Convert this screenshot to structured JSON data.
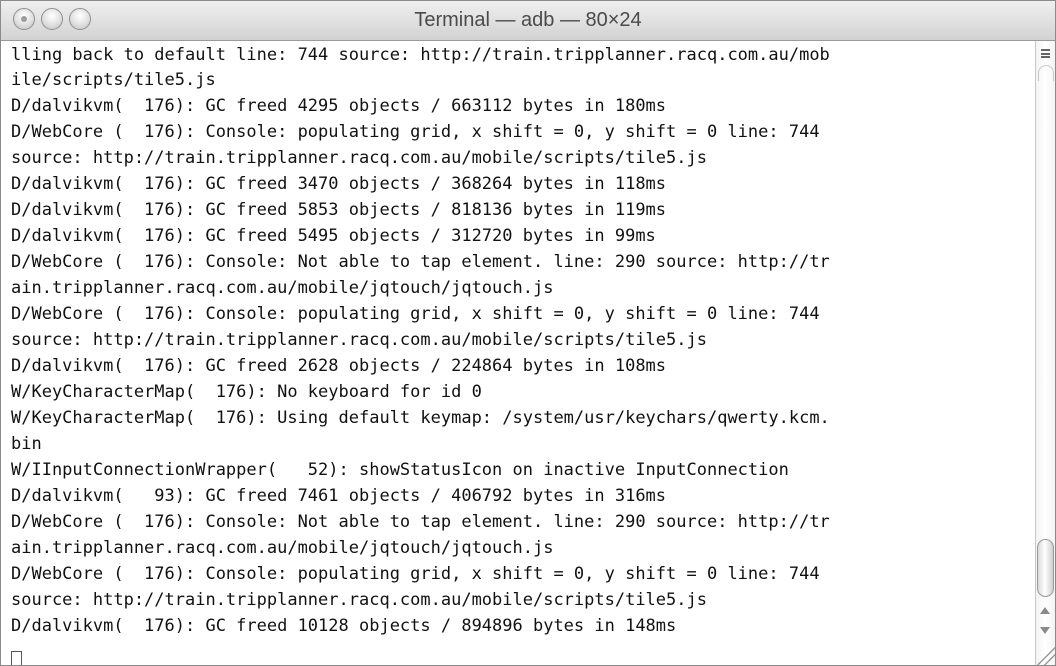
{
  "window": {
    "title": "Terminal — adb — 80×24"
  },
  "terminal": {
    "lines": [
      "lling back to default line: 744 source: http://train.tripplanner.racq.com.au/mob",
      "ile/scripts/tile5.js",
      "D/dalvikvm(  176): GC freed 4295 objects / 663112 bytes in 180ms",
      "D/WebCore (  176): Console: populating grid, x shift = 0, y shift = 0 line: 744",
      "source: http://train.tripplanner.racq.com.au/mobile/scripts/tile5.js",
      "D/dalvikvm(  176): GC freed 3470 objects / 368264 bytes in 118ms",
      "D/dalvikvm(  176): GC freed 5853 objects / 818136 bytes in 119ms",
      "D/dalvikvm(  176): GC freed 5495 objects / 312720 bytes in 99ms",
      "D/WebCore (  176): Console: Not able to tap element. line: 290 source: http://tr",
      "ain.tripplanner.racq.com.au/mobile/jqtouch/jqtouch.js",
      "D/WebCore (  176): Console: populating grid, x shift = 0, y shift = 0 line: 744",
      "source: http://train.tripplanner.racq.com.au/mobile/scripts/tile5.js",
      "D/dalvikvm(  176): GC freed 2628 objects / 224864 bytes in 108ms",
      "W/KeyCharacterMap(  176): No keyboard for id 0",
      "W/KeyCharacterMap(  176): Using default keymap: /system/usr/keychars/qwerty.kcm.",
      "bin",
      "W/IInputConnectionWrapper(   52): showStatusIcon on inactive InputConnection",
      "D/dalvikvm(   93): GC freed 7461 objects / 406792 bytes in 316ms",
      "D/WebCore (  176): Console: Not able to tap element. line: 290 source: http://tr",
      "ain.tripplanner.racq.com.au/mobile/jqtouch/jqtouch.js",
      "D/WebCore (  176): Console: populating grid, x shift = 0, y shift = 0 line: 744",
      "source: http://train.tripplanner.racq.com.au/mobile/scripts/tile5.js",
      "D/dalvikvm(  176): GC freed 10128 objects / 894896 bytes in 148ms"
    ]
  },
  "icons": {
    "close": "close-button-icon",
    "minimize": "minimize-button-icon",
    "zoom": "zoom-button-icon",
    "split": "split-pane-icon",
    "resize": "resize-grip-icon"
  }
}
